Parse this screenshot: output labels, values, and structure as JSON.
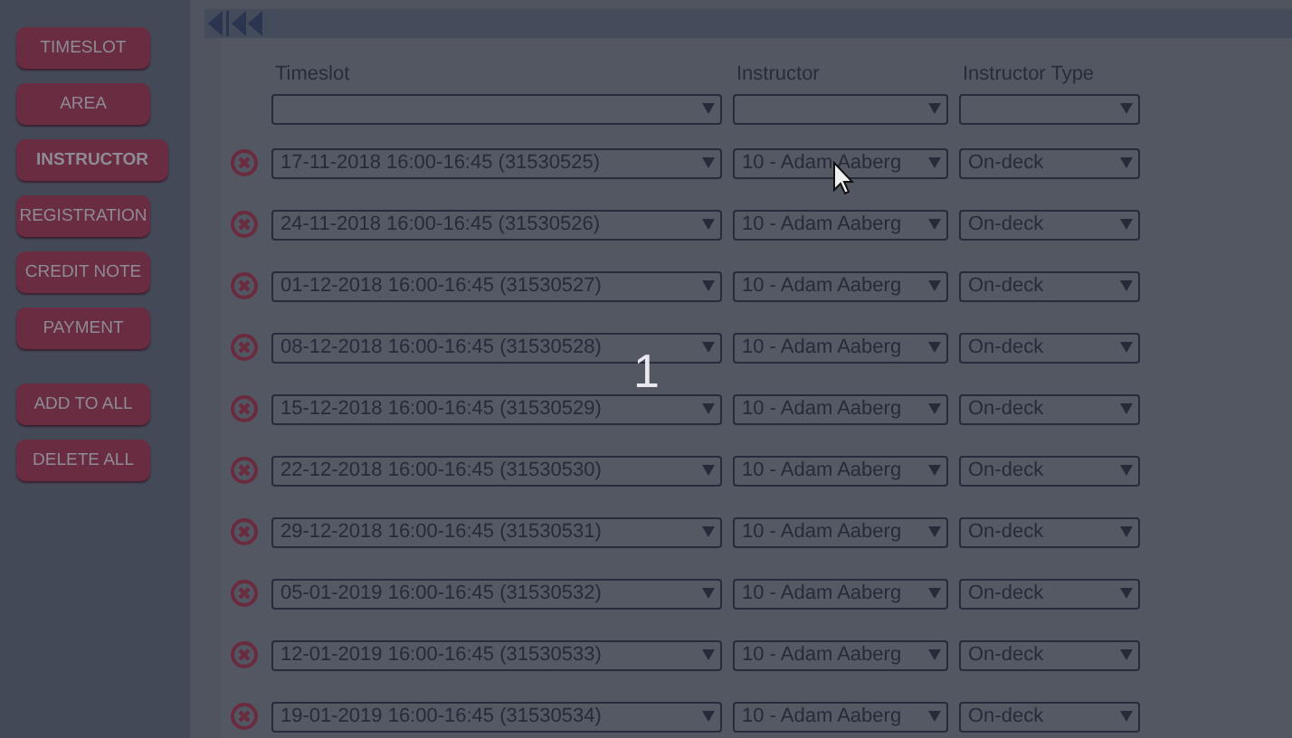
{
  "sidebar": {
    "buttons": [
      {
        "label": "TIMESLOT",
        "selected": false
      },
      {
        "label": "AREA",
        "selected": false
      },
      {
        "label": "INSTRUCTOR",
        "selected": true
      },
      {
        "label": "REGISTRATION",
        "selected": false
      },
      {
        "label": "CREDIT NOTE",
        "selected": false
      },
      {
        "label": "PAYMENT",
        "selected": false
      }
    ],
    "actions": [
      "ADD TO ALL",
      "DELETE ALL"
    ]
  },
  "table": {
    "columns": [
      "Timeslot",
      "Instructor",
      "Instructor Type"
    ],
    "rows": [
      {
        "timeslot": "17-11-2018 16:00-16:45 (31530525)",
        "instructor": "10 - Adam Aaberg",
        "type": "On-deck"
      },
      {
        "timeslot": "24-11-2018 16:00-16:45 (31530526)",
        "instructor": "10 - Adam Aaberg",
        "type": "On-deck"
      },
      {
        "timeslot": "01-12-2018 16:00-16:45 (31530527)",
        "instructor": "10 - Adam Aaberg",
        "type": "On-deck"
      },
      {
        "timeslot": "08-12-2018 16:00-16:45 (31530528)",
        "instructor": "10 - Adam Aaberg",
        "type": "On-deck"
      },
      {
        "timeslot": "15-12-2018 16:00-16:45 (31530529)",
        "instructor": "10 - Adam Aaberg",
        "type": "On-deck"
      },
      {
        "timeslot": "22-12-2018 16:00-16:45 (31530530)",
        "instructor": "10 - Adam Aaberg",
        "type": "On-deck"
      },
      {
        "timeslot": "29-12-2018 16:00-16:45 (31530531)",
        "instructor": "10 - Adam Aaberg",
        "type": "On-deck"
      },
      {
        "timeslot": "05-01-2019 16:00-16:45 (31530532)",
        "instructor": "10 - Adam Aaberg",
        "type": "On-deck"
      },
      {
        "timeslot": "12-01-2019 16:00-16:45 (31530533)",
        "instructor": "10 - Adam Aaberg",
        "type": "On-deck"
      },
      {
        "timeslot": "19-01-2019 16:00-16:45 (31530534)",
        "instructor": "10 - Adam Aaberg",
        "type": "On-deck"
      }
    ]
  },
  "overlay_number": "1"
}
